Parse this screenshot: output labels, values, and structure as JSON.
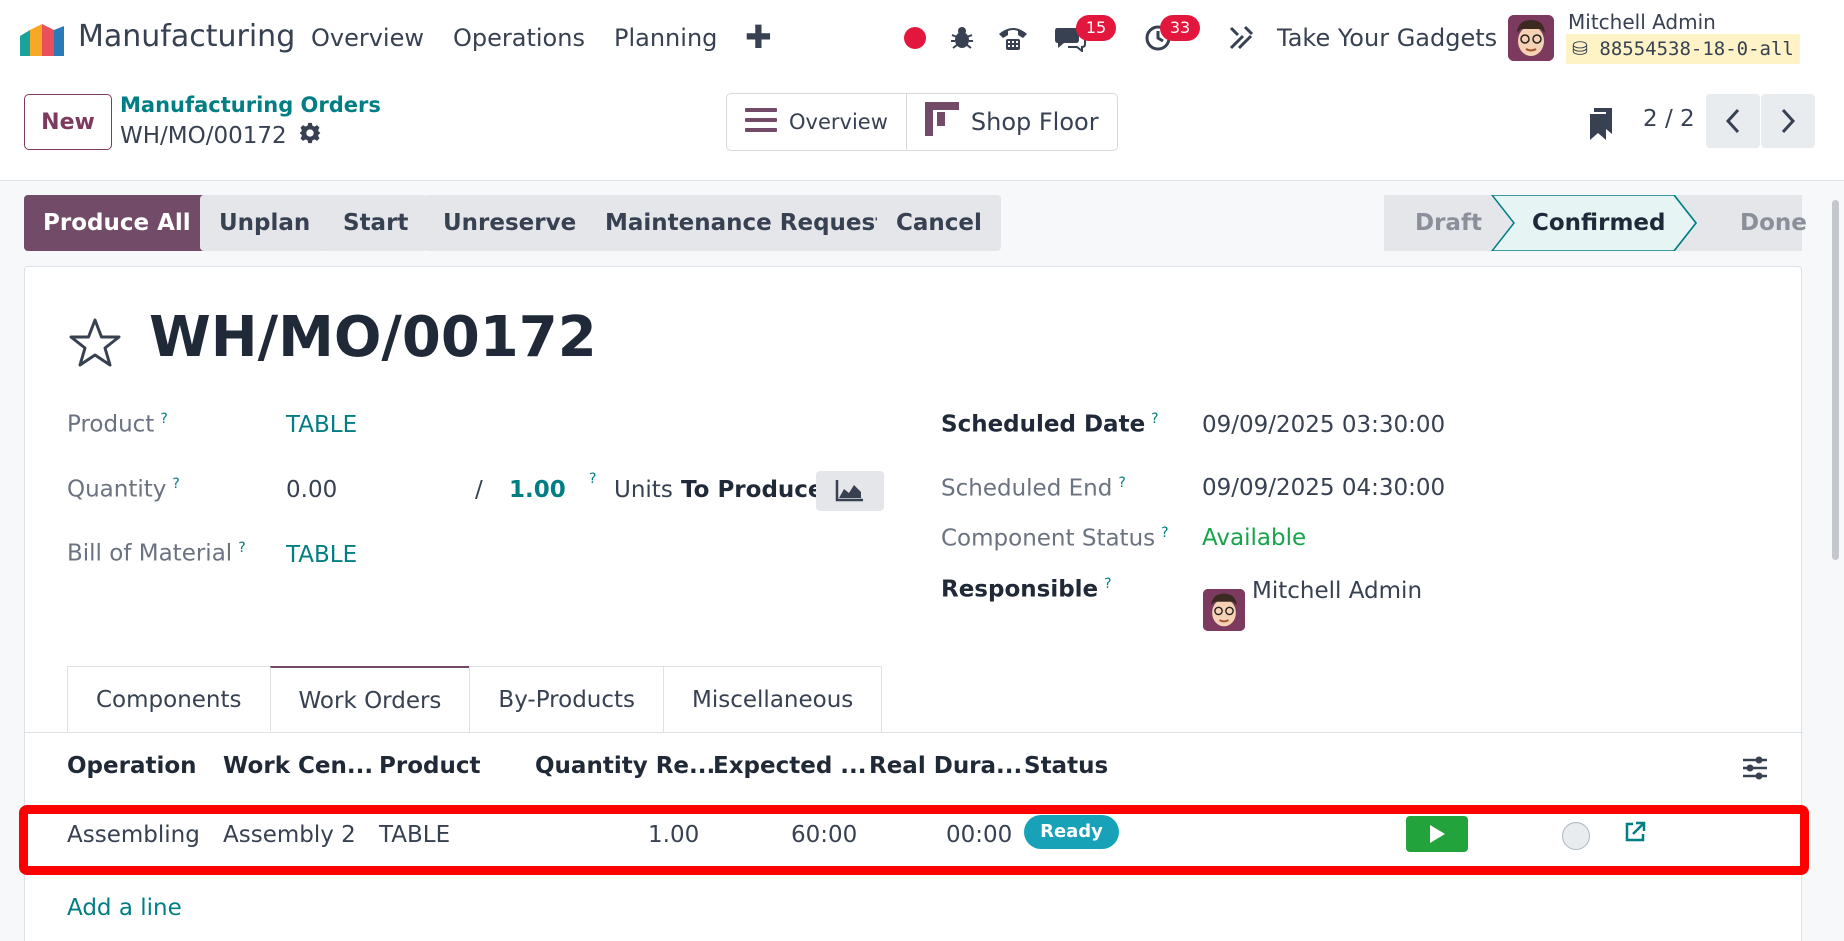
{
  "topbar": {
    "app_title": "Manufacturing",
    "menu": [
      "Overview",
      "Operations",
      "Planning"
    ],
    "chat_count": "15",
    "activity_count": "33",
    "company": "Take Your Gadgets",
    "user_name": "Mitchell Admin",
    "database": "88554538-18-0-all"
  },
  "control": {
    "new_label": "New",
    "breadcrumb_parent": "Manufacturing Orders",
    "breadcrumb_current": "WH/MO/00172",
    "view_overview": "Overview",
    "view_shop_floor": "Shop Floor",
    "pager": "2 / 2"
  },
  "actions": {
    "produce_all": "Produce All",
    "unplan": "Unplan",
    "start": "Start",
    "unreserve": "Unreserve",
    "maintenance": "Maintenance Request",
    "cancel": "Cancel"
  },
  "stages": {
    "draft": "Draft",
    "confirmed": "Confirmed",
    "done": "Done",
    "current": "Confirmed"
  },
  "record": {
    "title": "WH/MO/00172",
    "product_label": "Product",
    "product": "TABLE",
    "quantity_label": "Quantity",
    "quantity_produced": "0.00",
    "quantity_slash": "/",
    "quantity_to_produce": "1.00",
    "uom": "Units",
    "to_produce": "To Produce",
    "bom_label": "Bill of Material",
    "bom": "TABLE",
    "scheduled_date_label": "Scheduled Date",
    "scheduled_date": "09/09/2025 03:30:00",
    "scheduled_end_label": "Scheduled End",
    "scheduled_end": "09/09/2025 04:30:00",
    "component_status_label": "Component Status",
    "component_status": "Available",
    "responsible_label": "Responsible",
    "responsible": "Mitchell Admin",
    "help_mark": "?"
  },
  "tabs": [
    "Components",
    "Work Orders",
    "By-Products",
    "Miscellaneous"
  ],
  "active_tab": "Work Orders",
  "work_orders": {
    "columns": [
      "Operation",
      "Work Cen...",
      "Product",
      "Quantity Re...",
      "Expected ...",
      "Real Dura...",
      "Status"
    ],
    "rows": [
      {
        "operation": "Assembling",
        "work_center": "Assembly 2",
        "product": "TABLE",
        "quantity": "1.00",
        "expected": "60:00",
        "real_duration": "00:00",
        "status": "Ready"
      }
    ],
    "add_line": "Add a line"
  },
  "colors": {
    "primary": "#714b67",
    "link": "#017e84",
    "ready": "#17a2b8",
    "play": "#22a33b",
    "highlight": "#ff0000"
  }
}
